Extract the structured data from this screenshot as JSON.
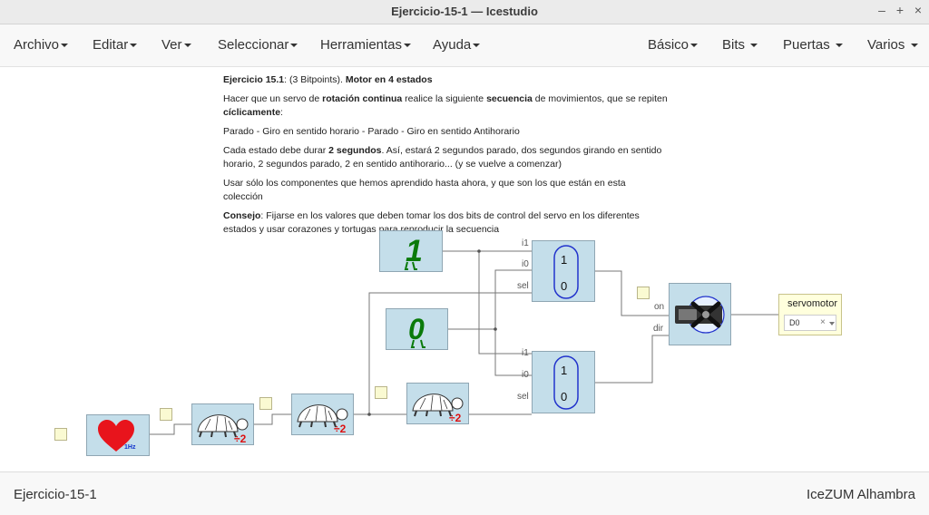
{
  "window": {
    "title": "Ejercicio-15-1 — Icestudio",
    "controls": [
      "–",
      "+",
      "×"
    ]
  },
  "menu": {
    "left": [
      "Archivo",
      "Editar",
      "Ver",
      "Seleccionar",
      "Herramientas",
      "Ayuda"
    ],
    "right": [
      "Básico",
      "Bits",
      "Puertas",
      "Varios"
    ]
  },
  "description": {
    "p1_head": "Ejercicio 15.1",
    "p1_mid": ": (3 Bitpoints). ",
    "p1_bold": "Motor en 4 estados",
    "p2_a": "Hacer que un servo de ",
    "p2_b": "rotación continua",
    "p2_c": " realice la siguiente ",
    "p2_d": "secuencia",
    "p2_e": " de movimientos, que se repiten ",
    "p2_f": "cíclicamente",
    "p2_g": ":",
    "p3": "Parado - Giro en sentido horario - Parado - Giro en sentido Antihorario",
    "p4_a": "Cada estado debe durar ",
    "p4_b": "2 segundos",
    "p4_c": ". Así, estará 2 segundos parado, dos segundos girando en sentido horario, 2 segundos parado, 2 en sentido antihorario... (y se vuelve a comenzar)",
    "p5": "Usar sólo los componentes que hemos aprendido hasta ahora, y que son los que están en esta colección",
    "p6_a": "Consejo",
    "p6_b": ": Fijarse en los valores que deben tomar los dos bits de control del servo en los diferentes estados y usar corazones y tortugas para reproducir la secuencia"
  },
  "blocks": {
    "const_one": "1",
    "const_zero": "0",
    "mux_top": {
      "v1": "1",
      "v0": "0",
      "i1": "i1",
      "i0": "i0",
      "sel": "sel"
    },
    "mux_bottom": {
      "v1": "1",
      "v0": "0",
      "i1": "i1",
      "i0": "i0",
      "sel": "sel"
    },
    "heart_freq": "1Hz",
    "div_label": "÷2",
    "servo_ports": {
      "on": "on",
      "dir": "dir"
    },
    "servomotor": {
      "label": "servomotor",
      "pin": "D0",
      "clear": "×"
    }
  },
  "status": {
    "left": "Ejercicio-15-1",
    "right": "IceZUM Alhambra"
  },
  "colors": {
    "block": "#c4deea",
    "wire": "#777777",
    "heart": "#e8141c",
    "ninja": "#0a7a0a",
    "mux_border": "#2233cc",
    "divide": "#dd1111"
  }
}
